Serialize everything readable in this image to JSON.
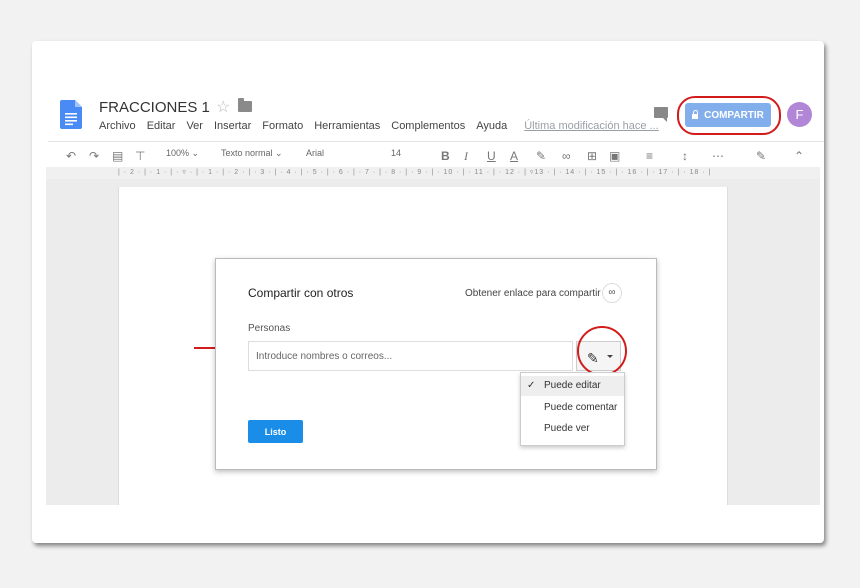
{
  "header": {
    "title": "FRACCIONES 1",
    "menu": [
      "Archivo",
      "Editar",
      "Ver",
      "Insertar",
      "Formato",
      "Herramientas",
      "Complementos",
      "Ayuda"
    ],
    "last_modified": "Última modificación hace ...",
    "share_label": "COMPARTIR",
    "avatar_initial": "F"
  },
  "toolbar": {
    "zoom": "100%",
    "style": "Texto normal",
    "font": "Arial",
    "size": "14"
  },
  "ruler": "| · 2 · | · 1 · | · ▿ · | · 1 · | · 2 · | · 3 · | · 4 · | · 5 · | · 6 · | · 7 · | · 8 · | · 9 · | · 10 · | · 11 · | · 12 · | ▿13 · | · 14 · | · 15 · | · 16 · | · 17 · | · 18 · |",
  "dialog": {
    "title": "Compartir con otros",
    "link_label": "Obtener enlace para compartir",
    "people_label": "Personas",
    "input_placeholder": "Introduce nombres o correos...",
    "done_label": "Listo",
    "permissions": [
      {
        "label": "Puede editar",
        "selected": true
      },
      {
        "label": "Puede comentar",
        "selected": false
      },
      {
        "label": "Puede ver",
        "selected": false
      }
    ]
  },
  "colors": {
    "share_button": "#82aeec",
    "done_button": "#1a8de8",
    "highlight": "#d21c1c",
    "avatar": "#b186d6"
  }
}
